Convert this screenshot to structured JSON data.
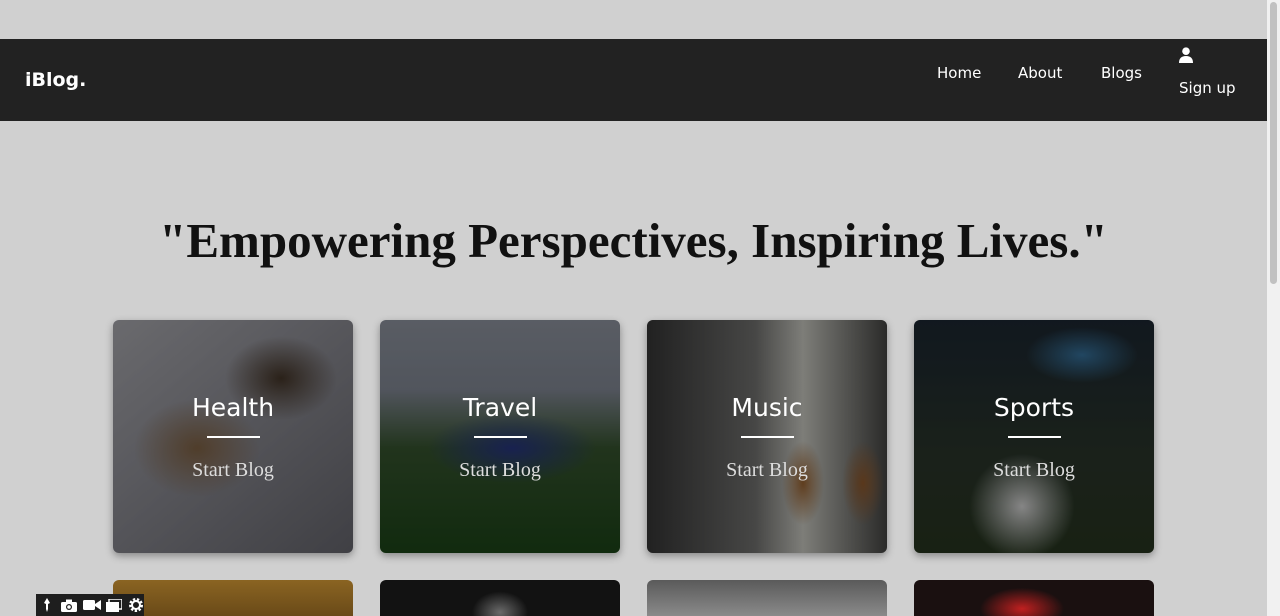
{
  "header": {
    "brand": "iBlog.",
    "nav": [
      {
        "label": "Home"
      },
      {
        "label": "About"
      },
      {
        "label": "Blogs"
      }
    ],
    "signup_label": "Sign up"
  },
  "hero": {
    "quote": "\"Empowering Perspectives, Inspiring Lives.\""
  },
  "categories": [
    {
      "title": "Health",
      "cta": "Start Blog"
    },
    {
      "title": "Travel",
      "cta": "Start Blog"
    },
    {
      "title": "Music",
      "cta": "Start Blog"
    },
    {
      "title": "Sports",
      "cta": "Start Blog"
    }
  ],
  "colors": {
    "navbar": "#222222",
    "page_bg": "#d0d0d0",
    "text_light": "#ffffff"
  },
  "icons": {
    "user": "user-icon",
    "recorder": [
      "pin-icon",
      "camera-icon",
      "video-icon",
      "window-icon",
      "gear-icon"
    ]
  }
}
